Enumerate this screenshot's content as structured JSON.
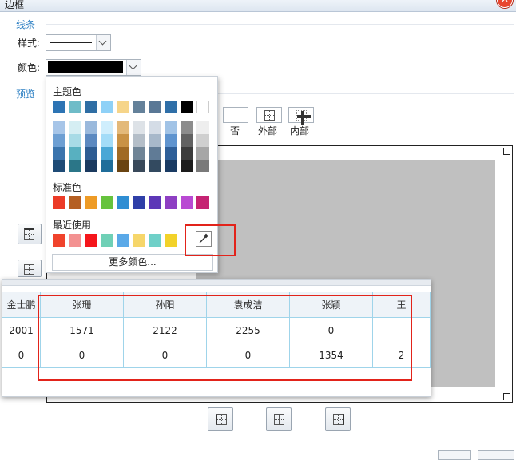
{
  "dialog": {
    "title": "边框"
  },
  "lines": {
    "section_title": "线条",
    "style_label": "样式:",
    "color_label": "颜色:",
    "selected_color": "#000000"
  },
  "preview": {
    "section_title": "预览",
    "presets": [
      {
        "label": "否",
        "icon": "none-border-icon"
      },
      {
        "label": "外部",
        "icon": "outer-border-icon"
      },
      {
        "label": "内部",
        "icon": "inner-border-icon"
      }
    ]
  },
  "color_picker": {
    "theme_title": "主题色",
    "theme_top": [
      "#2d74b4",
      "#6fbcc8",
      "#2f6ea4",
      "#8fd1f7",
      "#f6d58a",
      "#64819a",
      "#5a7896",
      "#2f6fa8",
      "#000000",
      "#ffffff"
    ],
    "theme_cols": [
      [
        "#a6c5e8",
        "#6d9fd3",
        "#3a74ad",
        "#1e4b76"
      ],
      [
        "#d5eef3",
        "#a8dbe6",
        "#58b0c0",
        "#2b7688"
      ],
      [
        "#9ab9dc",
        "#5c89c0",
        "#2d5c92",
        "#1b3a5f"
      ],
      [
        "#cfeefd",
        "#a3dcf8",
        "#4aa7d6",
        "#1f6d9a"
      ],
      [
        "#e3b97a",
        "#c99245",
        "#a06a24",
        "#6a4412"
      ],
      [
        "#dde2e7",
        "#b4bec8",
        "#6f8496",
        "#39495a"
      ],
      [
        "#d4dce6",
        "#a7b8ca",
        "#607b96",
        "#334a60"
      ],
      [
        "#a1c3e6",
        "#5f94cf",
        "#2e5f99",
        "#1a3b63"
      ],
      [
        "#8c8c8c",
        "#626262",
        "#3c3c3c",
        "#1c1c1c"
      ],
      [
        "#eeeeee",
        "#cfcfcf",
        "#a6a6a6",
        "#7a7a7a"
      ]
    ],
    "standard_title": "标准色",
    "standard": [
      "#ec3b27",
      "#b55f22",
      "#ee9b26",
      "#66c33d",
      "#2f8ed3",
      "#2f3fa8",
      "#5d37b7",
      "#8e3fc3",
      "#b94ad3",
      "#c52373"
    ],
    "recent_title": "最近使用",
    "recent": [
      "#f0432c",
      "#f39191",
      "#f5161b",
      "#6fd0b6",
      "#5aa9e8",
      "#f6d66a",
      "#6fd0c8",
      "#f2d22a"
    ],
    "eyedropper_icon": "eyedropper-icon",
    "more_colors": "更多颜色..."
  },
  "table": {
    "headers": [
      "金士鹏",
      "张珊",
      "孙阳",
      "袁成洁",
      "张颖",
      "王"
    ],
    "rows": [
      [
        "2001",
        "1571",
        "2122",
        "2255",
        "0",
        ""
      ],
      [
        "0",
        "0",
        "0",
        "0",
        "1354",
        "2"
      ]
    ]
  }
}
